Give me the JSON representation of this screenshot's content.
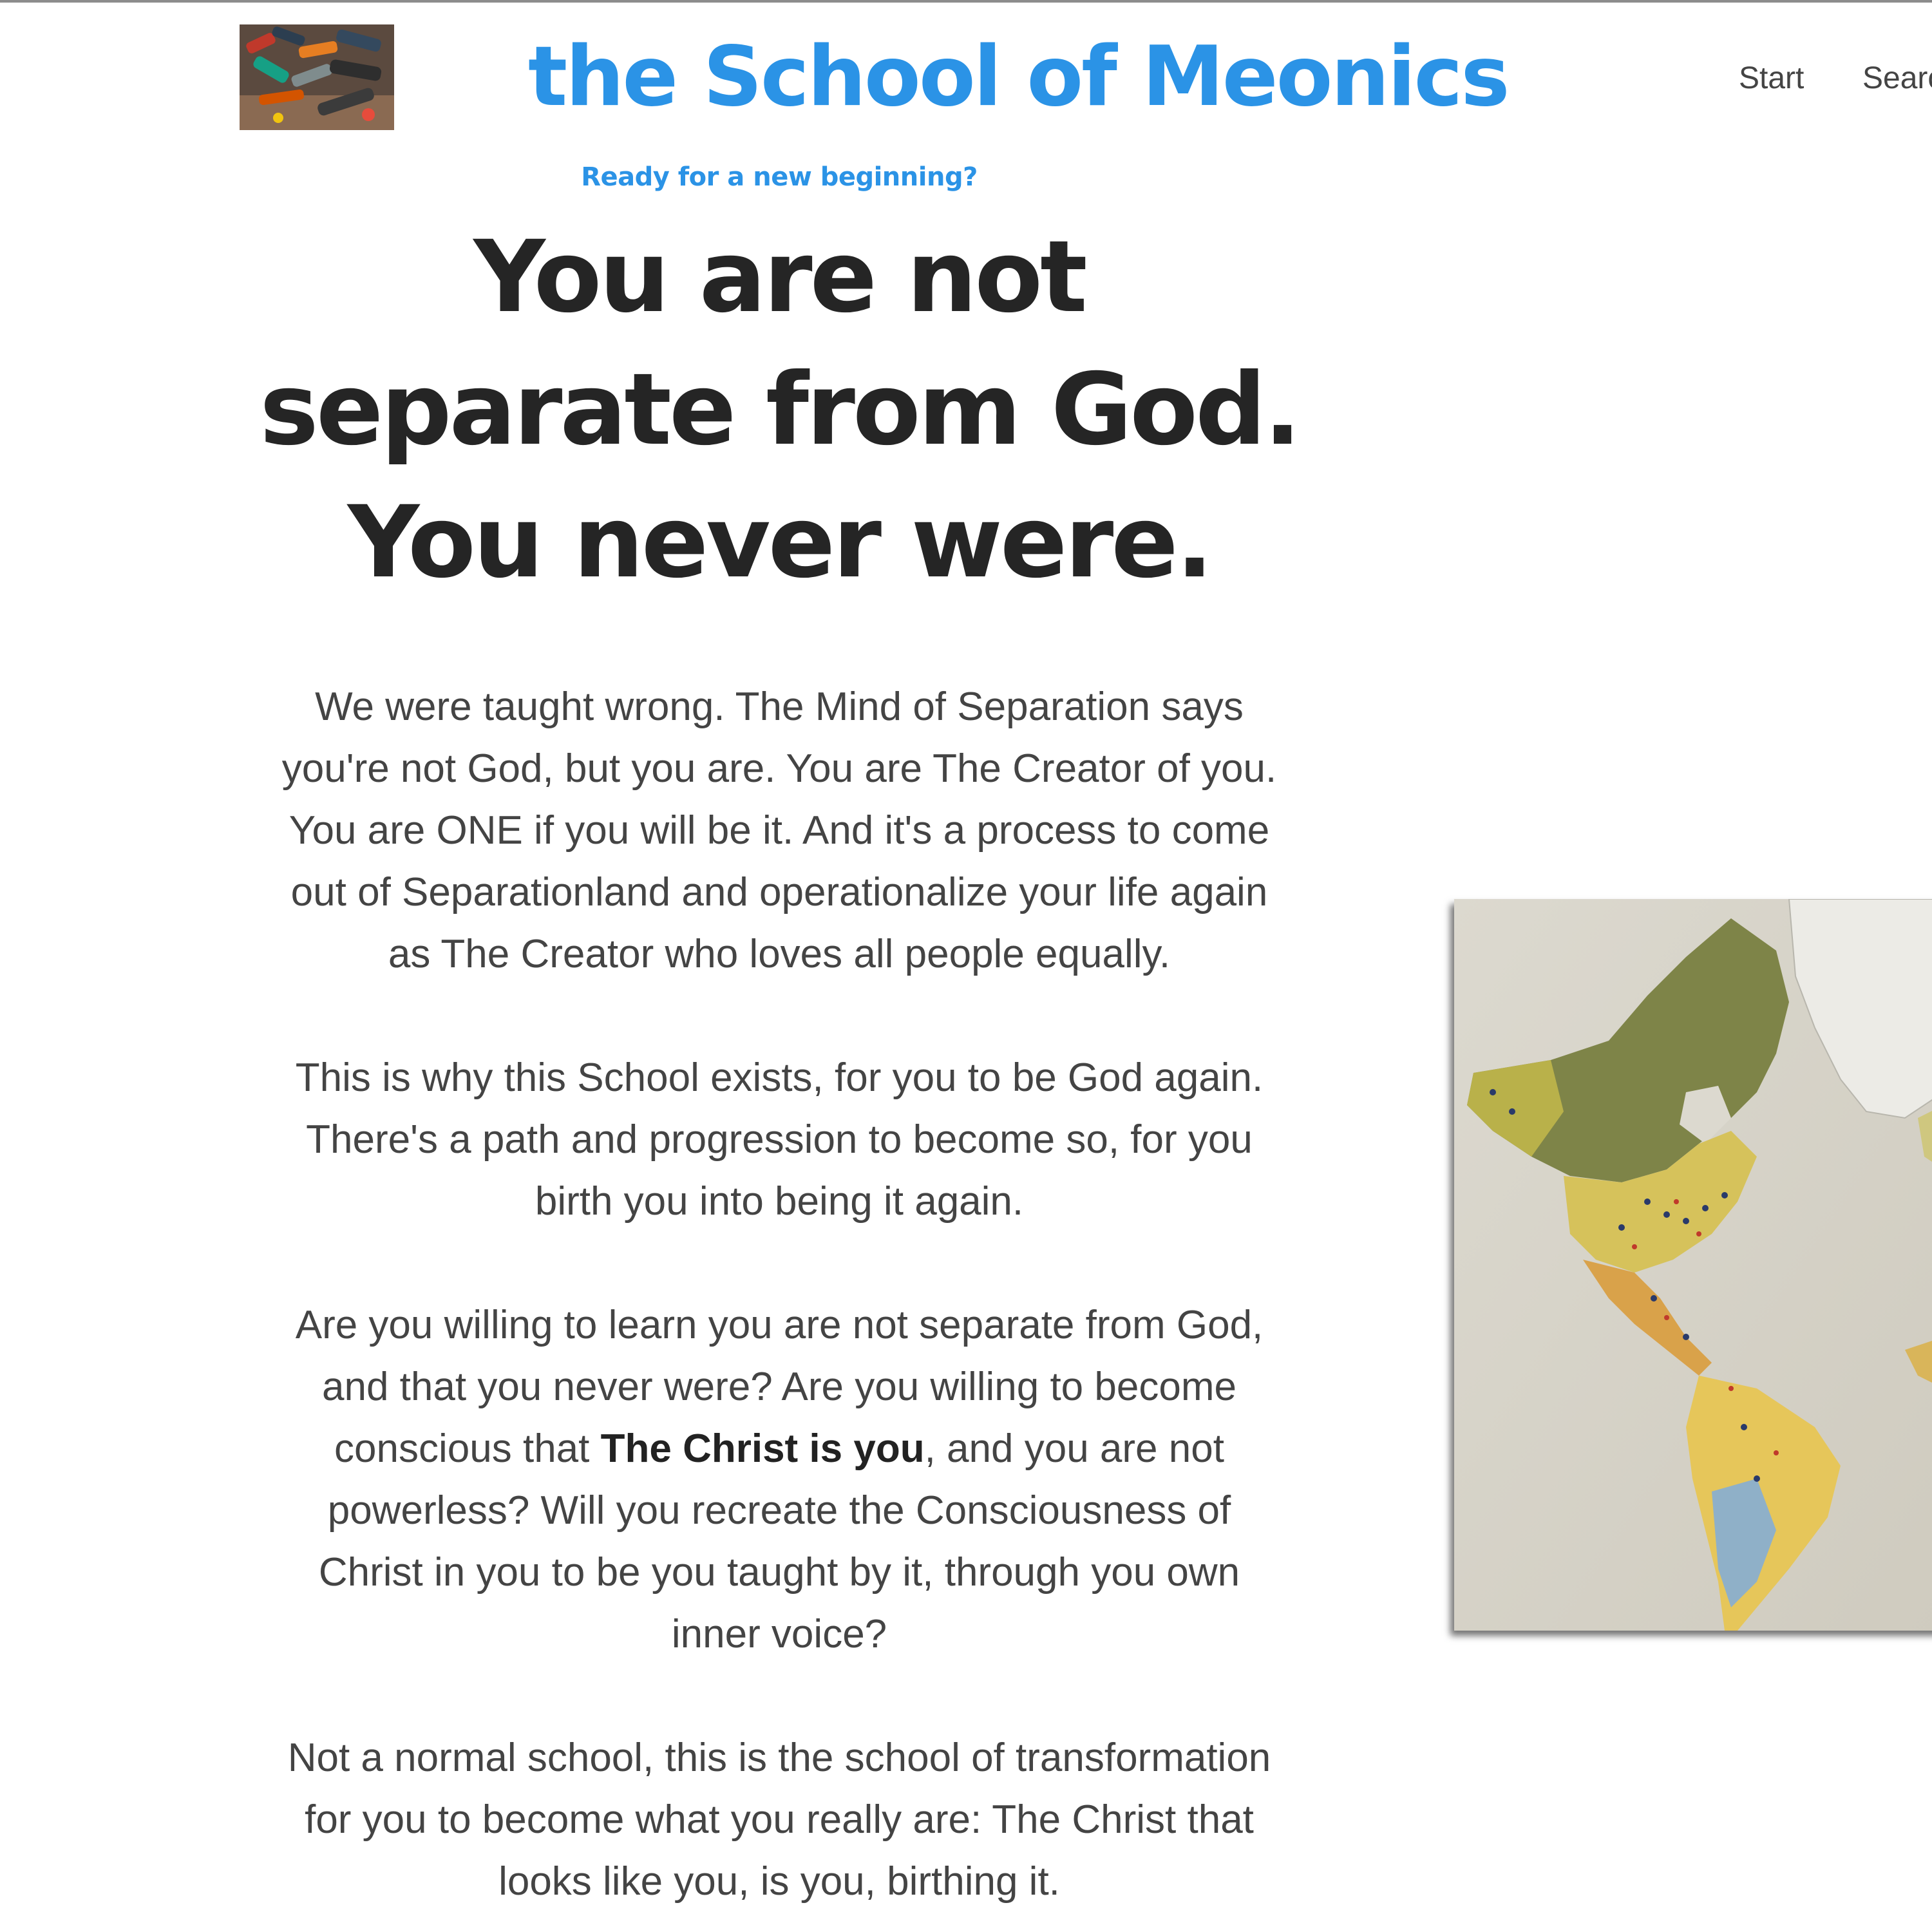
{
  "header": {
    "site_title": "the School of Meonics",
    "nav": [
      {
        "label": "Start"
      },
      {
        "label": "Search"
      }
    ]
  },
  "hero": {
    "tagline": "Ready for a new beginning?",
    "headline_lines": [
      "You are not",
      "separate from God.",
      "You never were."
    ]
  },
  "body": {
    "p1": [
      "We were taught wrong. The Mind of Separation says",
      "you're not God, but you are. You are The Creator of you.",
      "You are ONE if you will be it. And it's a process to come",
      "out of Separationland and operationalize your life again",
      "as The Creator who loves all people equally."
    ],
    "p2": [
      "This is why this School exists, for you to be God again.",
      "There's a path and progression to become so, for you",
      "birth you into being it again."
    ],
    "p3": {
      "line1": "Are you willing to learn you are not separate from God,",
      "line2": "and that you never were? Are you willing to become",
      "line3_before": "conscious that ",
      "line3_bold": "The Christ is you",
      "line3_after": ", and you are not",
      "line4": "powerless? Will you recreate the Consciousness of",
      "line5": "Christ in you to be you taught by it, through you own",
      "line6": "inner voice?"
    },
    "p4": [
      "Not a normal school, this is the school of transformation",
      "for you to become what you really are: The Christ that",
      "looks like you, is you, birthing it."
    ]
  },
  "colors": {
    "brand_blue": "#2b93e6",
    "headline": "#252525",
    "body_text": "#444444"
  },
  "images": {
    "logo": "paint-tubes-photo",
    "map": "world-map-with-pins-photo"
  }
}
